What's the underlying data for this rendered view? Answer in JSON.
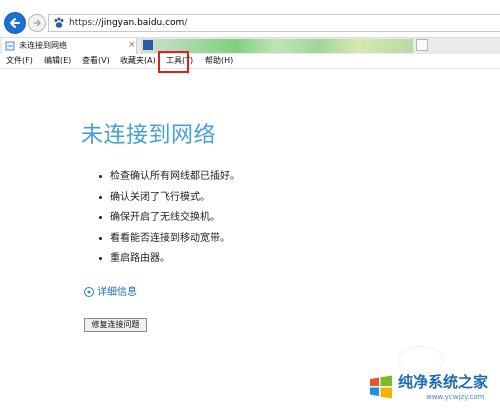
{
  "browser": {
    "url": {
      "scheme": "https://",
      "host": "jingyan.baidu.com",
      "path": "/"
    },
    "tabs": [
      {
        "label": "未连接到网络",
        "close": "×",
        "active": true
      },
      {
        "label": "",
        "active": false
      }
    ]
  },
  "menu": [
    {
      "label": "文件(F)"
    },
    {
      "label": "编辑(E)"
    },
    {
      "label": "查看(V)"
    },
    {
      "label": "收藏夹(A)"
    },
    {
      "label": "工具(T)"
    },
    {
      "label": "帮助(H)"
    }
  ],
  "page": {
    "title": "未连接到网络",
    "reasons": [
      "检查确认所有网线都已插好。",
      "确认关闭了飞行模式。",
      "确保开启了无线交换机。",
      "看看能否连接到移动宽带。",
      "重启路由器。"
    ],
    "details_label": "详细信息",
    "fix_button": "修复连接问题"
  },
  "watermark": {
    "title": "纯净系统之家",
    "url": "www.ycwjzy.com"
  },
  "colors": {
    "title": "#46a0d8",
    "link": "#1d6fb8",
    "highlight": "#e0201b",
    "back_button": "#1e6fd1"
  },
  "icons": {
    "back": "arrow-left-icon",
    "forward": "arrow-right-icon",
    "favicon": "baidu-paw-icon",
    "new_tab": "new-tab-icon",
    "details": "chevron-down-circle-icon",
    "watermark_logo": "windows-logo-icon"
  }
}
